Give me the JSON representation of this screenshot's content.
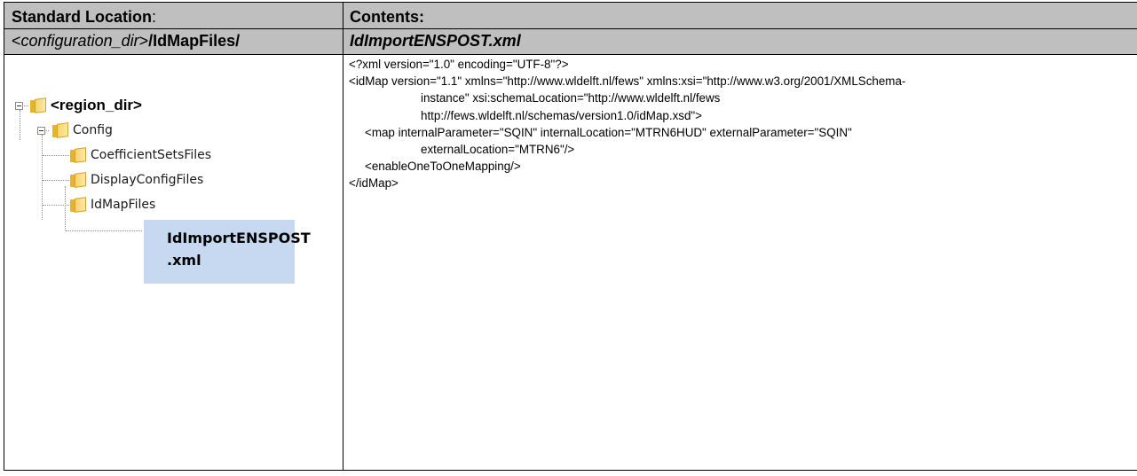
{
  "header": {
    "location_label": "Standard Location",
    "location_colon": ":",
    "location_dir_open": "<",
    "location_dir": "configuration_dir",
    "location_dir_close": ">",
    "location_subdir": "/IdMapFiles/",
    "contents_label": "Contents:",
    "contents_file": "IdImportENSPOST.xml"
  },
  "tree": {
    "root": "<region_dir>",
    "config": "Config",
    "children": [
      "CoefficientSetsFiles",
      "DisplayConfigFiles",
      "IdMapFiles"
    ],
    "file_line1": "IdImportENSPOST",
    "file_line2": ".xml"
  },
  "code": {
    "lines": [
      "<?xml version=\"1.0\" encoding=\"UTF-8\"?>",
      "<idMap version=\"1.1\" xmlns=\"http://www.wldelft.nl/fews\" xmlns:xsi=\"http://www.w3.org/2001/XMLSchema-",
      "instance\" xsi:schemaLocation=\"http://www.wldelft.nl/fews",
      "http://fews.wldelft.nl/schemas/version1.0/idMap.xsd\">",
      "<map internalParameter=\"SQIN\" internalLocation=\"MTRN6HUD\" externalParameter=\"SQIN\"",
      "externalLocation=\"MTRN6\"/>",
      "<enableOneToOneMapping/>",
      "</idMap>"
    ]
  }
}
